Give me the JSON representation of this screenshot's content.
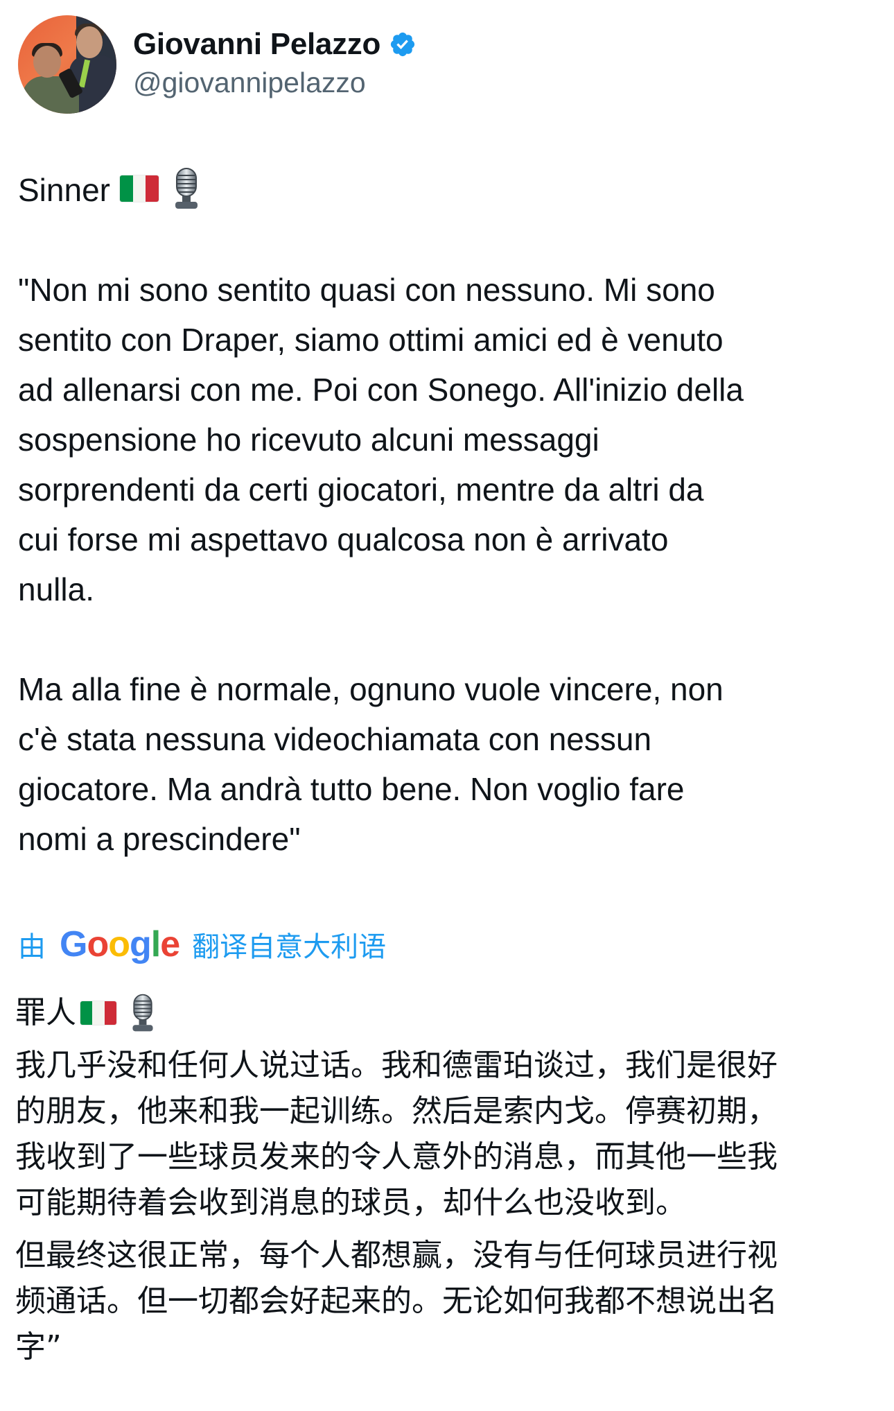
{
  "author": {
    "display_name": "Giovanni Pelazzo",
    "handle": "@giovannipelazzo",
    "verified_icon": "verified-badge-icon",
    "verified_color": "#1d9bf0"
  },
  "tweet": {
    "title": "Sinner",
    "emojis": [
      "italy-flag-icon",
      "microphone-icon"
    ],
    "paragraph_1": "\"Non mi sono sentito quasi con nessuno. Mi sono\nsentito con Draper, siamo ottimi amici ed è venuto\nad allenarsi con me. Poi con Sonego. All'inizio della\nsospensione ho ricevuto alcuni messaggi\nsorprendenti da certi giocatori, mentre da altri da\ncui forse mi aspettavo qualcosa non è arrivato\nnulla.",
    "paragraph_2": "Ma alla fine è normale, ognuno vuole vincere, non\nc'è stata nessuna videochiamata con nessun\ngiocatore. Ma andrà tutto bene. Non voglio fare\nnomi a prescindere\""
  },
  "translation": {
    "prefix": "由",
    "provider": "Google",
    "suffix": "翻译自意大利语",
    "link_color": "#1d9bf0"
  },
  "translated_tweet": {
    "title": "罪人",
    "paragraph_1": "我几乎没和任何人说过话。我和德雷珀谈过，我们是很好\n的朋友，他来和我一起训练。然后是索内戈。停赛初期，\n我收到了一些球员发来的令人意外的消息，而其他一些我\n可能期待着会收到消息的球员，却什么也没收到。",
    "paragraph_2": "但最终这很正常，每个人都想赢，没有与任何球员进行视\n频通话。但一切都会好起来的。无论如何我都不想说出名\n字”"
  }
}
